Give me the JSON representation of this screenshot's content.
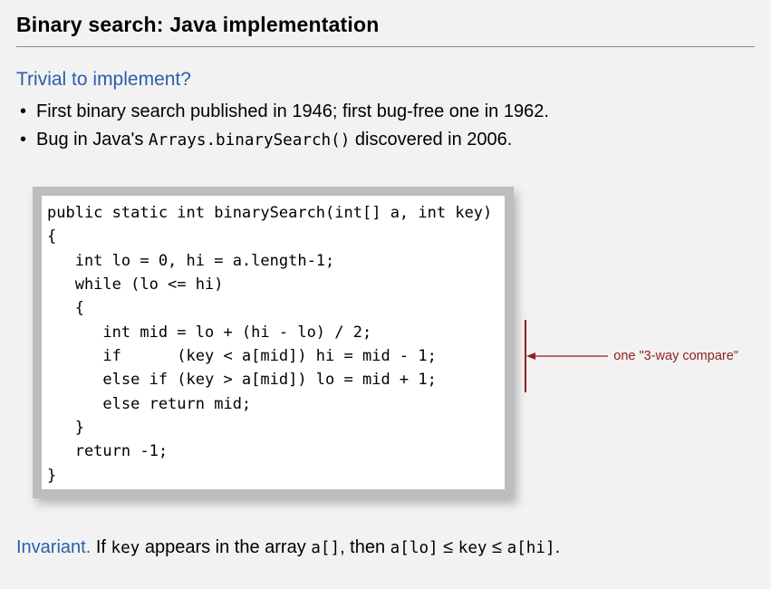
{
  "title": "Binary search:  Java implementation",
  "subhead": "Trivial to implement?",
  "bullets": [
    {
      "text": "First binary search published in 1946; first bug-free one in 1962."
    },
    {
      "pre": "Bug in Java's ",
      "code": "Arrays.binarySearch()",
      "post": " discovered in 2006."
    }
  ],
  "code": "public static int binarySearch(int[] a, int key)\n{\n   int lo = 0, hi = a.length-1;\n   while (lo <= hi)\n   {\n      int mid = lo + (hi - lo) / 2;\n      if      (key < a[mid]) hi = mid - 1;\n      else if (key > a[mid]) lo = mid + 1;\n      else return mid;\n   }\n   return -1;\n}",
  "annotation": "one \"3-way compare\"",
  "invariant": {
    "label": "Invariant.",
    "pre": "  If ",
    "key": "key",
    "mid1": " appears in the array ",
    "arr": "a[]",
    "mid2": ", then ",
    "lo": "a[lo]",
    "le1": " ≤ ",
    "key2": "key",
    "le2": " ≤ ",
    "hi": "a[hi]",
    "end": "."
  }
}
